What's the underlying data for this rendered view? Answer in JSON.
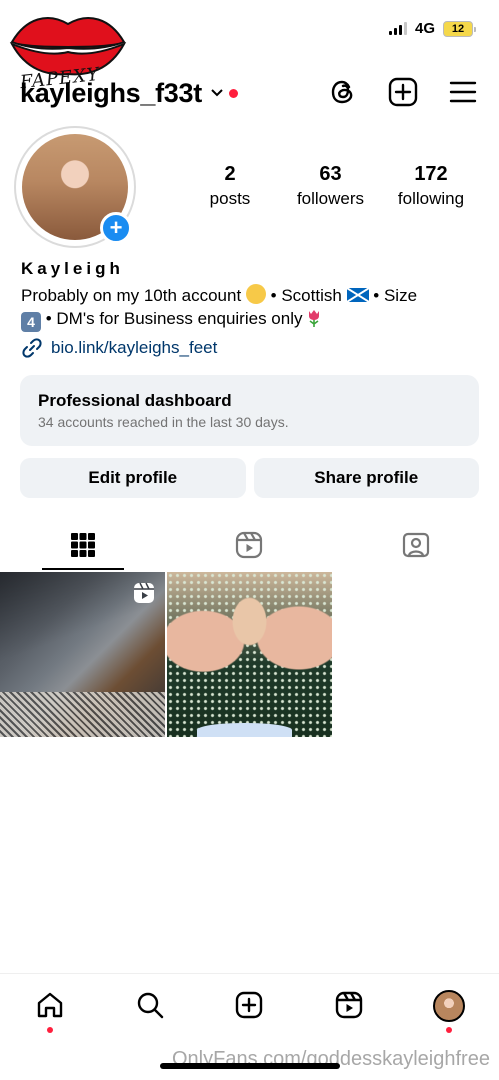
{
  "status_bar": {
    "network": "4G",
    "battery": "12"
  },
  "logo": {
    "text": "FAPEXY"
  },
  "header": {
    "username": "kayleighs_f33t",
    "icons": [
      "threads-icon",
      "create-icon",
      "menu-icon"
    ]
  },
  "profile": {
    "stats": [
      {
        "value": "2",
        "label": "posts"
      },
      {
        "value": "63",
        "label": "followers"
      },
      {
        "value": "172",
        "label": "following"
      }
    ],
    "name": "Kayleigh",
    "bio": {
      "part1": "Probably on my 10th account",
      "part2": "• Scottish",
      "part3": "• Size",
      "keycap": "4",
      "part4": "• DM's for Business enquiries only"
    },
    "link": "bio.link/kayleighs_feet"
  },
  "dashboard": {
    "title": "Professional dashboard",
    "subtitle": "34 accounts reached in the last 30 days."
  },
  "buttons": {
    "edit": "Edit profile",
    "share": "Share profile"
  },
  "tabs": [
    "grid-icon",
    "reels-icon",
    "tagged-icon"
  ],
  "posts": [
    {
      "type": "reel"
    },
    {
      "type": "photo"
    }
  ],
  "bottom_nav": [
    "home-icon",
    "search-icon",
    "create-icon",
    "reels-icon",
    "profile-avatar"
  ],
  "watermark": "OnlyFans.com/goddesskayleighfree",
  "colors": {
    "accent_blue": "#1a8cf1",
    "notification_red": "#ff1f3d",
    "link_blue": "#00376b",
    "button_gray": "#eff2f5"
  }
}
